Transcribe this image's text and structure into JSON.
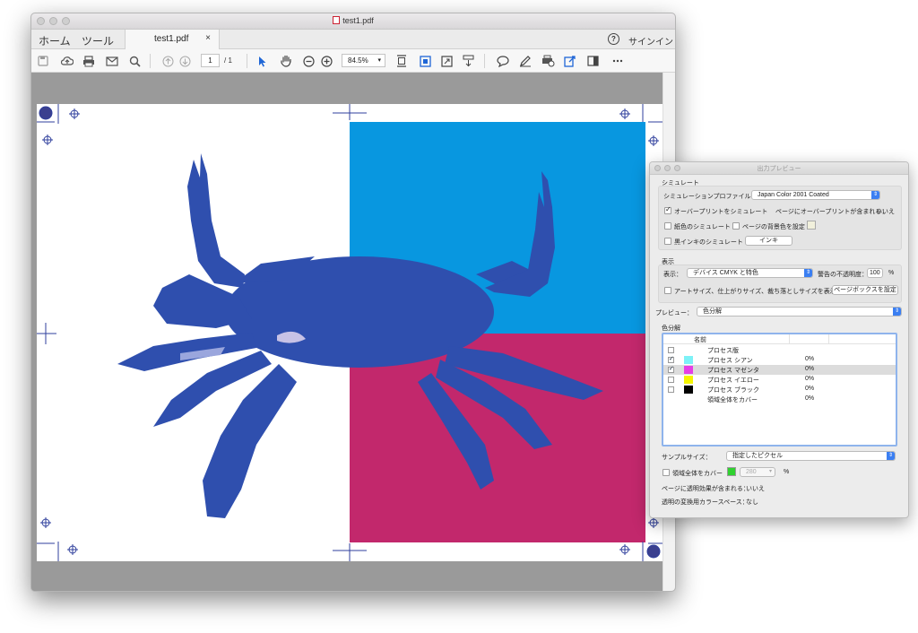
{
  "window": {
    "title": "test1.pdf"
  },
  "tabs": {
    "home": "ホーム",
    "tools": "ツール",
    "doc": "test1.pdf",
    "doc_close": "×"
  },
  "header": {
    "help": "?",
    "signin": "サインイン"
  },
  "toolbar": {
    "page_current": "1",
    "page_total": "/ 1",
    "zoom": "84.5%"
  },
  "panel": {
    "title": "出力プレビュー",
    "simulate_header": "シミュレート",
    "profile_label": "シミュレーションプロファイル：",
    "profile_value": "Japan Color 2001 Coated",
    "overprint_label": "オーバープリントをシミュレート",
    "overprint_checked": true,
    "page_overprint_label": "ページにオーバープリントが含まれる：",
    "page_overprint_value": "いいえ",
    "paper_color_label": "紙色のシミュレート",
    "bg_color_label": "ページの背景色を設定",
    "black_ink_label": "黒インキのシミュレート",
    "ink_button": "インキ",
    "display_header": "表示",
    "show_label": "表示：",
    "show_value": "デバイス CMYK と特色",
    "opacity_label": "警告の不透明度：",
    "opacity_value": "100",
    "opacity_unit": "%",
    "artsize_label": "アートサイズ、仕上がりサイズ、裁ち落としサイズを表示",
    "pagebox_button": "ページボックスを設定",
    "preview_label": "プレビュー：",
    "preview_value": "色分解",
    "separations_header": "色分解",
    "col_name": "名前",
    "separations": [
      {
        "name": "プロセス版",
        "pct": "",
        "checked": false,
        "swatch": ""
      },
      {
        "name": "プロセス シアン",
        "pct": "0%",
        "checked": true,
        "swatch": "#7df2f7"
      },
      {
        "name": "プロセス マゼンタ",
        "pct": "0%",
        "checked": true,
        "swatch": "#e63ee6"
      },
      {
        "name": "プロセス イエロー",
        "pct": "0%",
        "checked": false,
        "swatch": "#f5f500"
      },
      {
        "name": "プロセス ブラック",
        "pct": "0%",
        "checked": false,
        "swatch": "#000000"
      },
      {
        "name": "領域全体をカバー",
        "pct": "0%",
        "checked": false,
        "swatch": ""
      }
    ],
    "sample_label": "サンプルサイズ：",
    "sample_value": "指定したピクセル",
    "coverage_label": "領域全体をカバー",
    "coverage_value": "280",
    "coverage_unit": "%",
    "transp_label": "ページに透明効果が含まれる：",
    "transp_value": "いいえ",
    "blend_label": "透明の変換用カラースペース：",
    "blend_value": "なし"
  },
  "colors": {
    "cyan_block": "#0897e0",
    "magenta_block": "#c2286c",
    "crab": "#2f4fae",
    "accent": "#3b7ff2"
  }
}
